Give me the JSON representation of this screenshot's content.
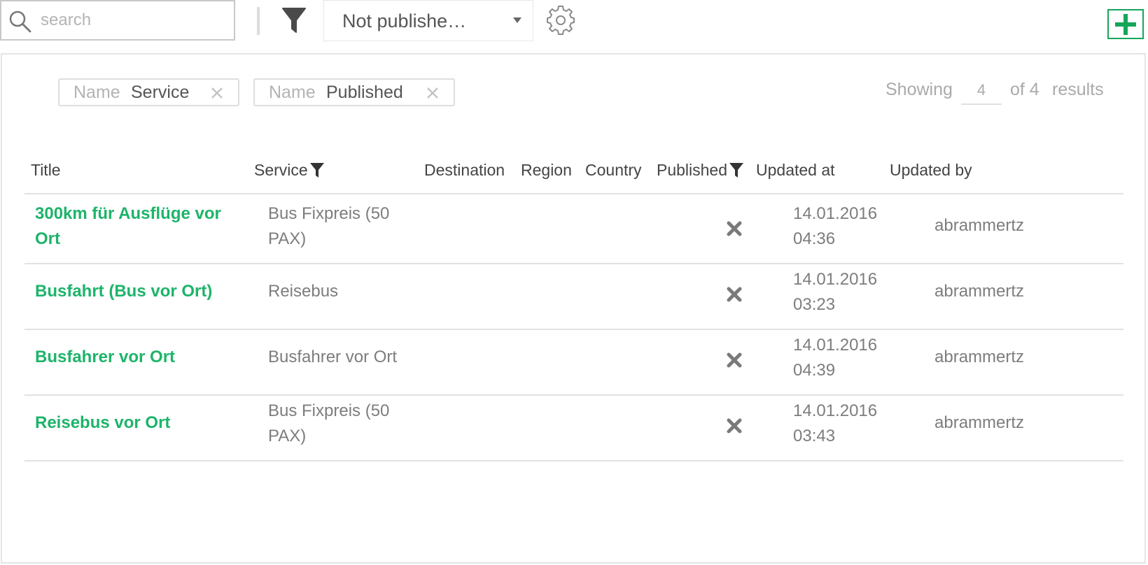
{
  "toolbar": {
    "search": {
      "placeholder": "search",
      "value": ""
    },
    "status_filter": {
      "selected": "Not publishe…"
    },
    "icons": {
      "search": "search-icon",
      "filter": "funnel-icon",
      "settings": "gear-icon",
      "add": "plus-icon"
    },
    "accent_color": "#15a659"
  },
  "active_filters": [
    {
      "key": "Name",
      "value": "Service"
    },
    {
      "key": "Name",
      "value": "Published"
    }
  ],
  "results": {
    "showing_label": "Showing",
    "page_size": "4",
    "of_label": "of 4",
    "results_label": "results"
  },
  "table": {
    "columns": [
      "Title",
      "Service",
      "Destination",
      "Region",
      "Country",
      "Published",
      "Updated at",
      "Updated by"
    ],
    "rows": [
      {
        "title": "300km für Ausflüge vor Ort",
        "service": "Bus Fixpreis (50 PAX)",
        "destination": "",
        "region": "",
        "country": "",
        "published": false,
        "updated_at": "14.01.2016 04:36",
        "updated_by": "abrammertz"
      },
      {
        "title": "Busfahrt (Bus vor Ort)",
        "service": "Reisebus",
        "destination": "",
        "region": "",
        "country": "",
        "published": false,
        "updated_at": "14.01.2016 03:23",
        "updated_by": "abrammertz"
      },
      {
        "title": "Busfahrer vor Ort",
        "service": "Busfahrer vor Ort",
        "destination": "",
        "region": "",
        "country": "",
        "published": false,
        "updated_at": "14.01.2016 04:39",
        "updated_by": "abrammertz"
      },
      {
        "title": "Reisebus vor Ort",
        "service": "Bus Fixpreis (50 PAX)",
        "destination": "",
        "region": "",
        "country": "",
        "published": false,
        "updated_at": "14.01.2016 03:43",
        "updated_by": "abrammertz"
      }
    ],
    "link_color": "#1db46a"
  }
}
